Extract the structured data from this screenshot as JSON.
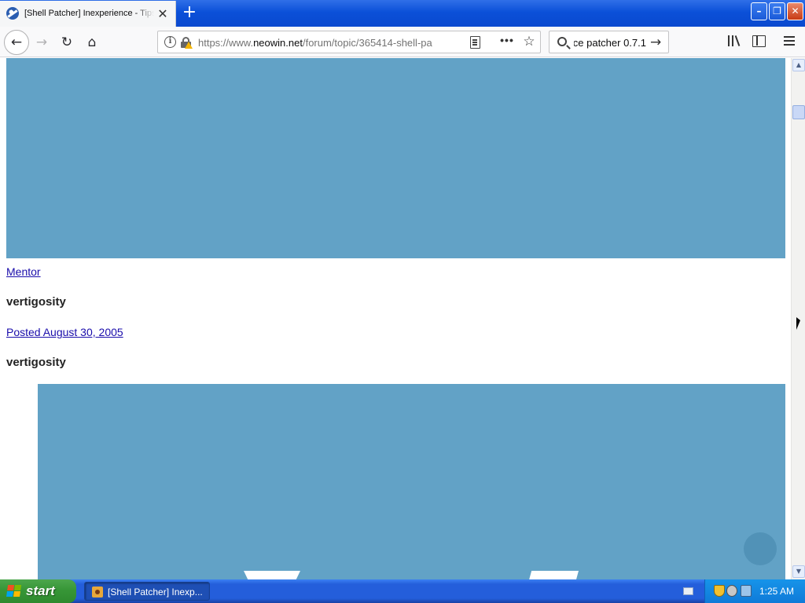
{
  "browser": {
    "tab_title": "[Shell Patcher] Inexperience - Tips",
    "url_scheme": "https://www.",
    "url_host": "neowin.net",
    "url_path": "/forum/topic/365414-shell-pa",
    "search_value": "ce patcher 0.7.1",
    "tab_close_glyph": "✕",
    "new_tab_glyph": "+",
    "back_glyph": "←",
    "forward_glyph": "→",
    "reload_glyph": "↻",
    "home_glyph": "⌂",
    "info_glyph": "i",
    "more_glyph": "•••",
    "star_glyph": "☆",
    "search_go_glyph": "→",
    "min_glyph": "–",
    "max_glyph": "❐",
    "close_glyph": "✕"
  },
  "page": {
    "mentor_link": "Mentor",
    "username_1": "vertigosity",
    "posted_link": "Posted August 30, 2005",
    "username_2": "vertigosity"
  },
  "scrollbar": {
    "up_glyph": "▲",
    "down_glyph": "▼"
  },
  "taskbar": {
    "start_label": "start",
    "task_label": "[Shell Patcher] Inexp...",
    "clock": "1:25 AM"
  },
  "colors": {
    "image_blue": "#62a2c6",
    "link": "#1a0dab",
    "taskbar_blue": "#245edb",
    "start_green": "#379637"
  }
}
